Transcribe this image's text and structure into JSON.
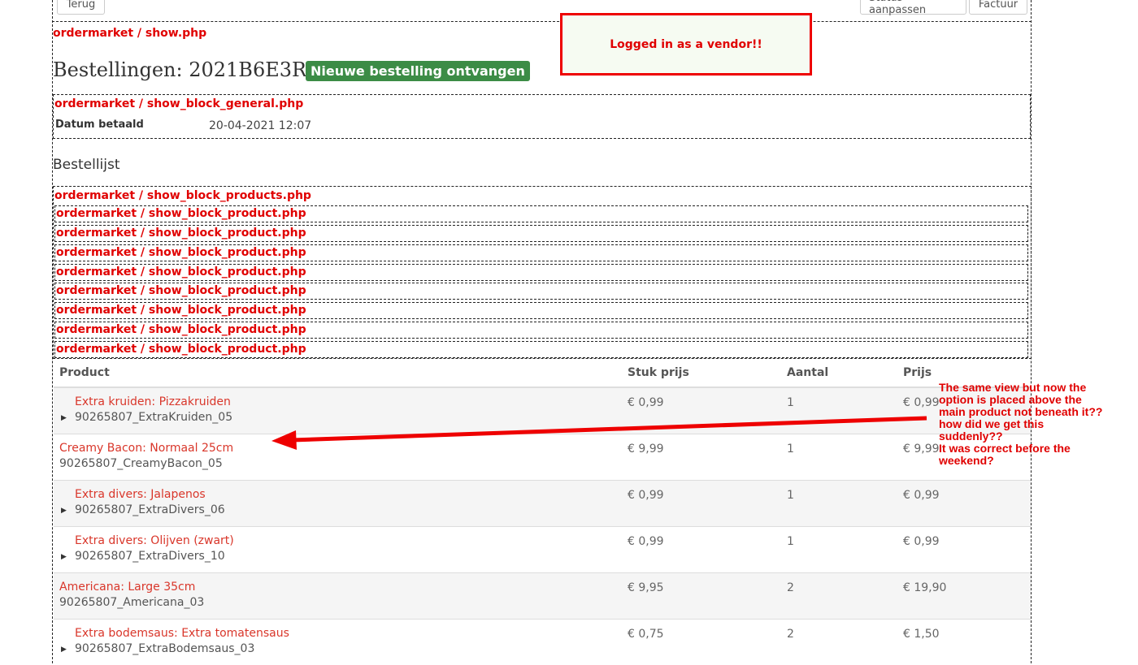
{
  "toolbar": {
    "back_label": "Terug",
    "status_label": "Status aanpassen",
    "invoice_label": "Factuur"
  },
  "debug": {
    "show": "ordermarket / show.php",
    "general": "ordermarket / show_block_general.php",
    "products": "ordermarket / show_block_products.php",
    "product": "ordermarket / show_block_product.php"
  },
  "vendor_note": "Logged in as a vendor!!",
  "order": {
    "heading": "Bestellingen: 2021B6E3R6",
    "badge": "Nieuwe bestelling ontvangen",
    "paid_label": "Datum betaald",
    "paid_value": "20-04-2021 12:07"
  },
  "section_title": "Bestellijst",
  "table": {
    "headers": [
      "Product",
      "Stuk prijs",
      "Aantal",
      "Prijs"
    ],
    "rows": [
      {
        "name": "Extra kruiden: Pizzakruiden",
        "sku": "90265807_ExtraKruiden_05",
        "unit": "€ 0,99",
        "qty": "1",
        "price": "€ 0,99"
      },
      {
        "name": "Creamy Bacon: Normaal 25cm",
        "sku": "90265807_CreamyBacon_05",
        "unit": "€ 9,99",
        "qty": "1",
        "price": "€ 9,99"
      },
      {
        "name": "Extra divers: Jalapenos",
        "sku": "90265807_ExtraDivers_06",
        "unit": "€ 0,99",
        "qty": "1",
        "price": "€ 0,99"
      },
      {
        "name": "Extra divers: Olijven (zwart)",
        "sku": "90265807_ExtraDivers_10",
        "unit": "€ 0,99",
        "qty": "1",
        "price": "€ 0,99"
      },
      {
        "name": "Americana: Large 35cm",
        "sku": "90265807_Americana_03",
        "unit": "€ 9,95",
        "qty": "2",
        "price": "€ 19,90"
      },
      {
        "name": "Extra bodemsaus: Extra tomatensaus",
        "sku": "90265807_ExtraBodemsaus_03",
        "unit": "€ 0,75",
        "qty": "2",
        "price": "€ 1,50"
      }
    ]
  },
  "annotation": {
    "line1": "The same view but now the",
    "line2": "option is placed above the",
    "line3": "main product not beneath it??",
    "line4": "how did we get this",
    "line5": "suddenly??",
    "line6": "It was correct before the",
    "line7": "weekend?"
  },
  "colors": {
    "debug_red": "#e00000",
    "badge_green": "#3c8c46",
    "product_link": "#d9362a"
  }
}
